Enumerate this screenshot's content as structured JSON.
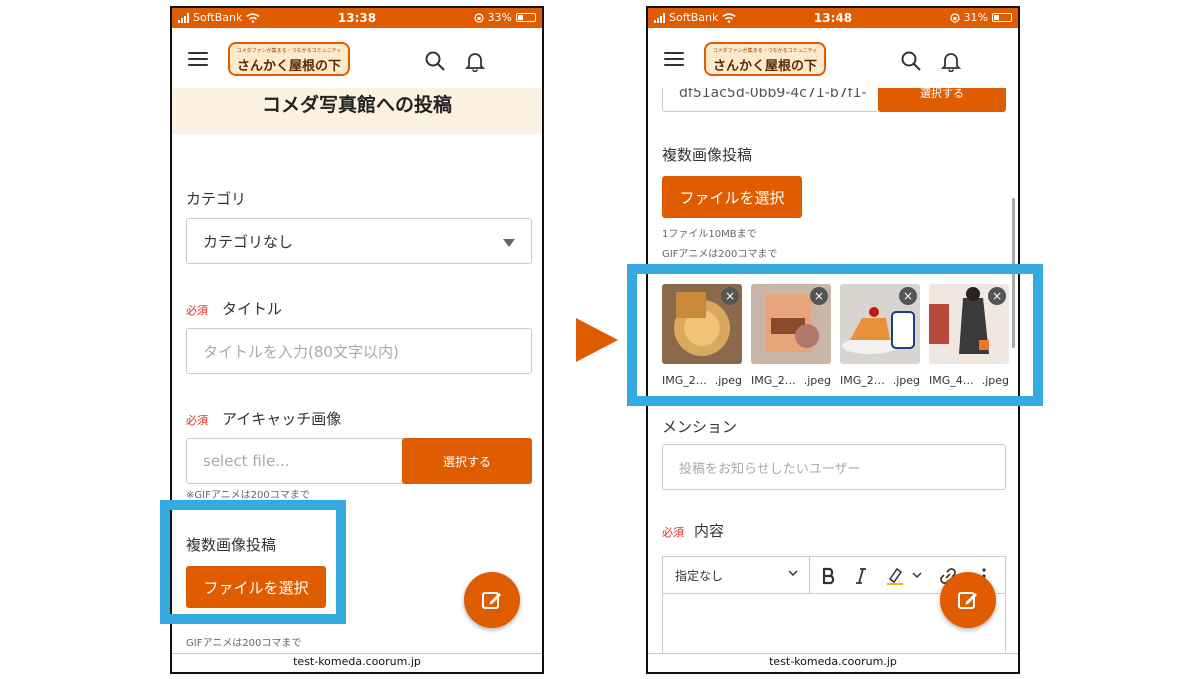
{
  "colors": {
    "accent": "#e05c00",
    "highlight": "#36a9e1",
    "required": "#d6322b",
    "title_band": "#fdf1e2"
  },
  "left": {
    "status": {
      "carrier": "SoftBank",
      "time": "13:38",
      "battery": "33%",
      "battery_fraction": 0.33
    },
    "header": {
      "logo_tagline": "コメダファンが集まる・つながるコミュニティ",
      "logo_name": "さんかく屋根の下"
    },
    "page_title": "コメダ写真館への投稿",
    "category": {
      "label": "カテゴリ",
      "value": "カテゴリなし"
    },
    "title_field": {
      "required": "必須",
      "label": "タイトル",
      "placeholder": "タイトルを入力(80文字以内)"
    },
    "eyecatch": {
      "required": "必須",
      "label": "アイキャッチ画像",
      "placeholder": "select file...",
      "button": "選択する",
      "note": "※GIFアニメは200コマまで"
    },
    "multi": {
      "label": "複数画像投稿",
      "button": "ファイルを選択",
      "note": "GIFアニメは200コマまで"
    },
    "url": "test-komeda.coorum.jp"
  },
  "right": {
    "status": {
      "carrier": "SoftBank",
      "time": "13:48",
      "battery": "31%",
      "battery_fraction": 0.31
    },
    "header": {
      "logo_tagline": "コメダファンが集まる・つながるコミュニティ",
      "logo_name": "さんかく屋根の下"
    },
    "file_id": {
      "value": "df51ac5d-0bb9-4c71-b7f1-",
      "button": "選択する"
    },
    "multi": {
      "label": "複数画像投稿",
      "button": "ファイルを選択",
      "note1": "1ファイル10MBまで",
      "note2": "GIFアニメは200コマまで"
    },
    "images": [
      {
        "name": "IMG_2…",
        "ext": ".jpeg"
      },
      {
        "name": "IMG_2…",
        "ext": ".jpeg"
      },
      {
        "name": "IMG_2…",
        "ext": ".jpeg"
      },
      {
        "name": "IMG_4…",
        "ext": ".jpeg"
      }
    ],
    "mention": {
      "label": "メンション",
      "placeholder": "投稿をお知らせしたいユーザー"
    },
    "content": {
      "required": "必須",
      "label": "内容",
      "format": "指定なし"
    },
    "url": "test-komeda.coorum.jp"
  }
}
